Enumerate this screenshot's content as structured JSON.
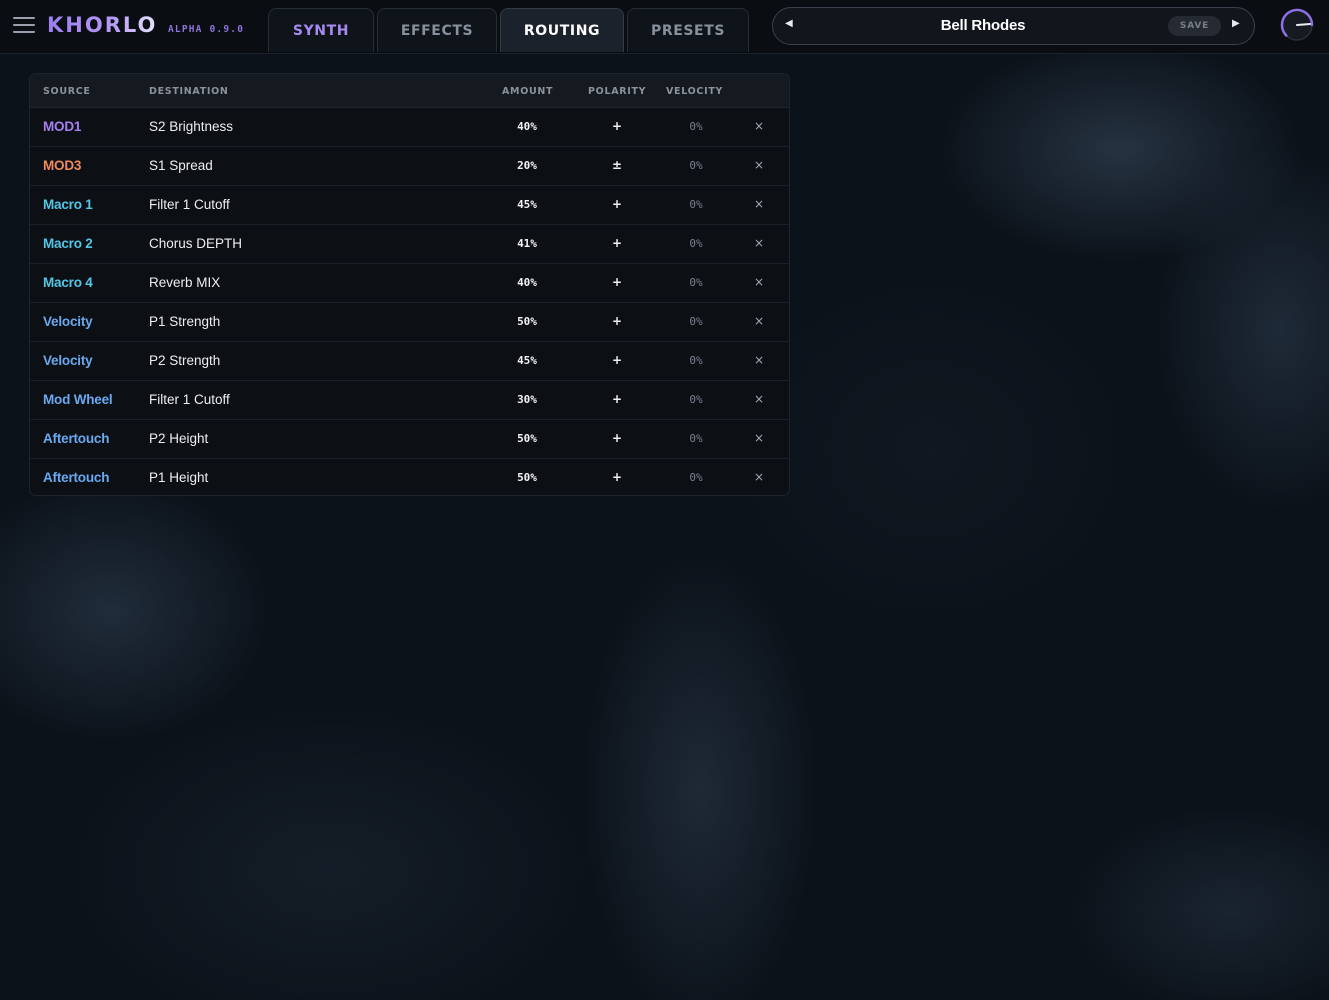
{
  "app": {
    "logo": "KHORLO",
    "version": "ALPHA 0.9.0",
    "accent_color": "#a68af0"
  },
  "tabs": [
    {
      "label": "SYNTH",
      "state": "accent"
    },
    {
      "label": "EFFECTS",
      "state": "inactive"
    },
    {
      "label": "ROUTING",
      "state": "active"
    },
    {
      "label": "PRESETS",
      "state": "inactive"
    }
  ],
  "preset": {
    "prev_icon": "triangle-left-icon",
    "name": "Bell Rhodes",
    "save_label": "SAVE",
    "next_icon": "triangle-right-icon"
  },
  "routing": {
    "headers": {
      "source": "SOURCE",
      "destination": "DESTINATION",
      "amount": "AMOUNT",
      "polarity": "POLARITY",
      "velocity": "VELOCITY"
    },
    "delete_icon": "close-icon",
    "rows": [
      {
        "source": "MOD1",
        "source_color": "#a67ff0",
        "destination": "S2 Brightness",
        "amount": "40%",
        "polarity": "+",
        "velocity": "0%",
        "delete": "×"
      },
      {
        "source": "MOD3",
        "source_color": "#ef8a5c",
        "destination": "S1 Spread",
        "amount": "20%",
        "polarity": "±",
        "velocity": "0%",
        "delete": "×"
      },
      {
        "source": "Macro 1",
        "source_color": "#54c6e6",
        "destination": "Filter 1 Cutoff",
        "amount": "45%",
        "polarity": "+",
        "velocity": "0%",
        "delete": "×"
      },
      {
        "source": "Macro 2",
        "source_color": "#54c6e6",
        "destination": "Chorus DEPTH",
        "amount": "41%",
        "polarity": "+",
        "velocity": "0%",
        "delete": "×"
      },
      {
        "source": "Macro 4",
        "source_color": "#54c6e6",
        "destination": "Reverb MIX",
        "amount": "40%",
        "polarity": "+",
        "velocity": "0%",
        "delete": "×"
      },
      {
        "source": "Velocity",
        "source_color": "#6aa9ef",
        "destination": "P1 Strength",
        "amount": "50%",
        "polarity": "+",
        "velocity": "0%",
        "delete": "×"
      },
      {
        "source": "Velocity",
        "source_color": "#6aa9ef",
        "destination": "P2 Strength",
        "amount": "45%",
        "polarity": "+",
        "velocity": "0%",
        "delete": "×"
      },
      {
        "source": "Mod Wheel",
        "source_color": "#6aa9ef",
        "destination": "Filter 1 Cutoff",
        "amount": "30%",
        "polarity": "+",
        "velocity": "0%",
        "delete": "×"
      },
      {
        "source": "Aftertouch",
        "source_color": "#6aa9ef",
        "destination": "P2 Height",
        "amount": "50%",
        "polarity": "+",
        "velocity": "0%",
        "delete": "×"
      },
      {
        "source": "Aftertouch",
        "source_color": "#6aa9ef",
        "destination": "P1 Height",
        "amount": "50%",
        "polarity": "+",
        "velocity": "0%",
        "delete": "×"
      }
    ]
  }
}
